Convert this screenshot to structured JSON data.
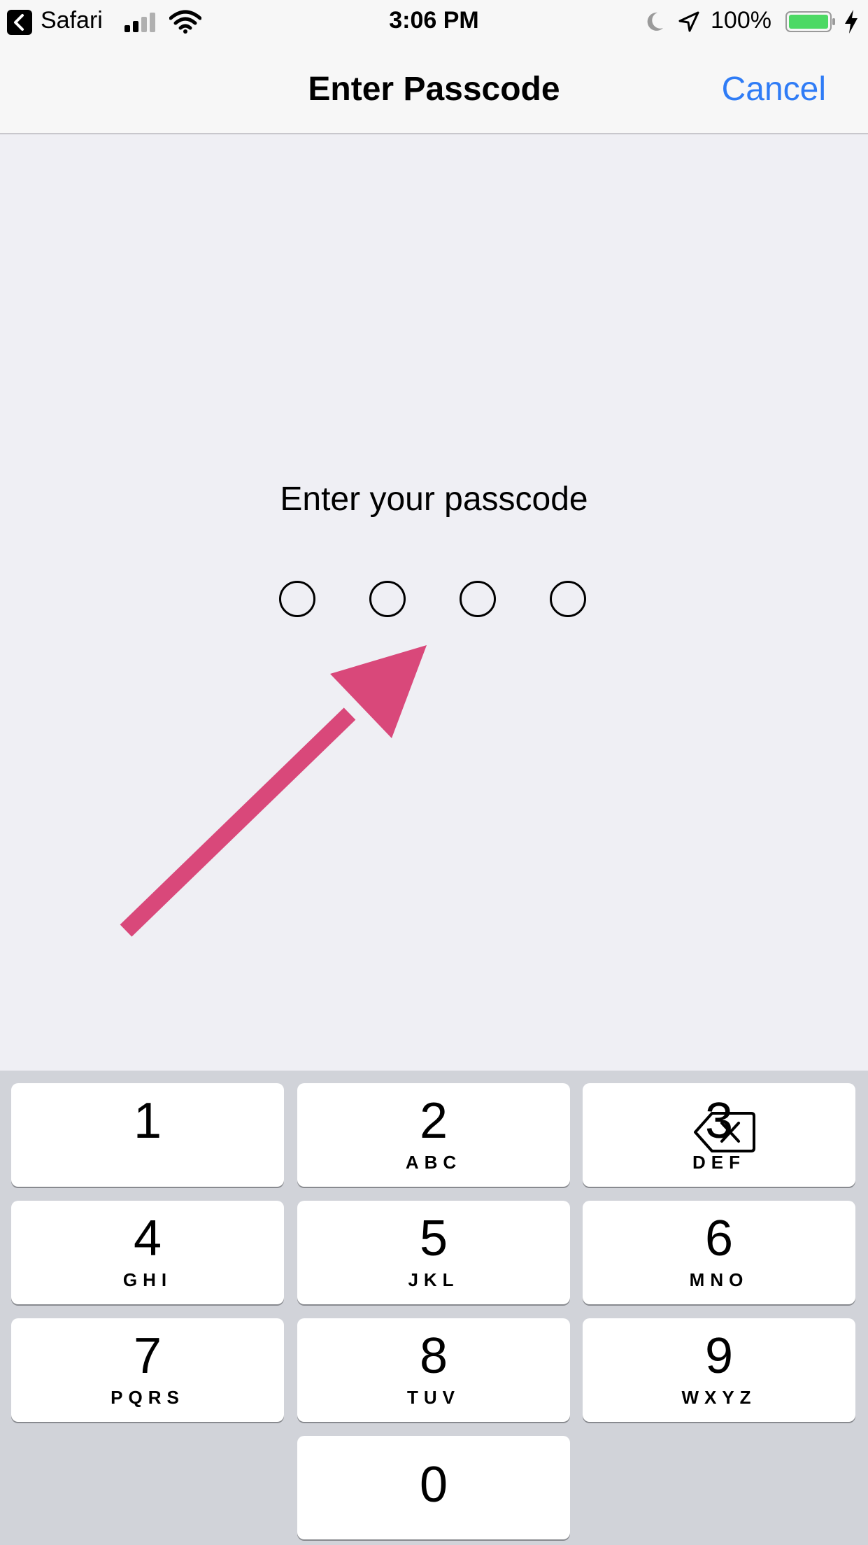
{
  "status_bar": {
    "back_app": "Safari",
    "time": "3:06 PM",
    "battery_percent": "100%",
    "icons": [
      "back-arrow-icon",
      "cellular-signal-icon",
      "wifi-icon",
      "moon-icon",
      "location-arrow-icon",
      "battery-icon",
      "charging-bolt-icon"
    ]
  },
  "nav_bar": {
    "title": "Enter Passcode",
    "cancel_label": "Cancel"
  },
  "passcode": {
    "prompt": "Enter your passcode",
    "digits_total": 4,
    "digits_entered": 0
  },
  "annotation": {
    "type": "arrow",
    "color": "#d9487a"
  },
  "keypad": {
    "keys": [
      {
        "digit": "1",
        "letters": ""
      },
      {
        "digit": "2",
        "letters": "ABC"
      },
      {
        "digit": "3",
        "letters": "DEF"
      },
      {
        "digit": "4",
        "letters": "GHI"
      },
      {
        "digit": "5",
        "letters": "JKL"
      },
      {
        "digit": "6",
        "letters": "MNO"
      },
      {
        "digit": "7",
        "letters": "PQRS"
      },
      {
        "digit": "8",
        "letters": "TUV"
      },
      {
        "digit": "9",
        "letters": "WXYZ"
      },
      {
        "digit": "0",
        "letters": ""
      }
    ],
    "delete_icon": "backspace-icon"
  },
  "colors": {
    "accent": "#2f7cf6",
    "background": "#efeff4",
    "keypad_background": "#d1d3d9",
    "battery_fill": "#4cd964"
  }
}
